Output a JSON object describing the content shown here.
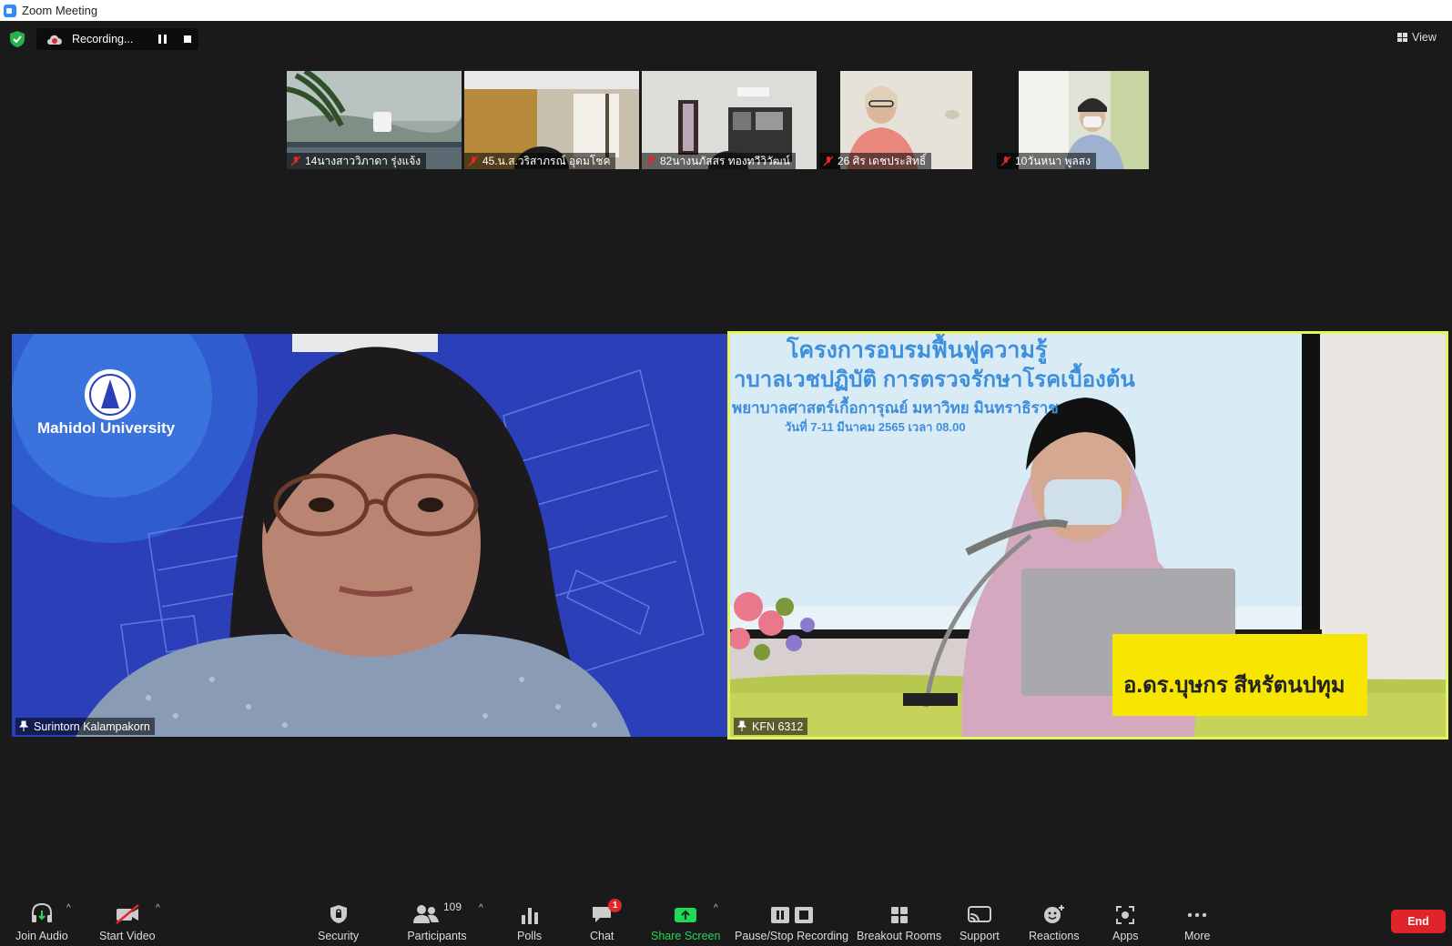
{
  "window": {
    "title": "Zoom Meeting"
  },
  "recording": {
    "status": "Recording..."
  },
  "view": {
    "label": "View"
  },
  "gallery": [
    {
      "name": "14นางสาววิภาดา รุ่งแจ้ง"
    },
    {
      "name": "45.น.ส.วริสาภรณ์ อุดมโชค"
    },
    {
      "name": "82นางนภัสสร ทองทวีวิวัฒน์"
    },
    {
      "name": "26 ศิร เดชประสิทธิ์"
    },
    {
      "name": "10วันหนา พูลสง"
    }
  ],
  "main_tiles": [
    {
      "name": "Surintorn Kalampakorn",
      "logo_text": "Mahidol University"
    },
    {
      "name": "KFN 6312",
      "slide_line1": "โครงการอบรมฟื้นฟูความรู้",
      "slide_line2": "าบาลเวชปฏิบัติ การตรวจรักษาโรคเบื้องต้น",
      "slide_line3": "พยาบาลศาสตร์เกื้อการุณย์ มหาวิทย     มินทราธิราช",
      "slide_line4": "วันที่ 7-11 มีนาคม 2565 เวลา 08.00",
      "nameplate": "อ.ดร.บุษกร  สีหรัตนปทุม"
    }
  ],
  "toolbar": {
    "join_audio": "Join Audio",
    "start_video": "Start Video",
    "security": "Security",
    "participants": "Participants",
    "participants_count": "109",
    "polls": "Polls",
    "chat": "Chat",
    "chat_badge": "1",
    "share_screen": "Share Screen",
    "pause_stop": "Pause/Stop Recording",
    "breakout": "Breakout Rooms",
    "support": "Support",
    "reactions": "Reactions",
    "apps": "Apps",
    "more": "More",
    "end": "End"
  },
  "colors": {
    "active_speaker": "#e3f55a",
    "share_green": "#23d959",
    "end_red": "#e0242b",
    "mahidol_blue": "#2a3fb8"
  }
}
